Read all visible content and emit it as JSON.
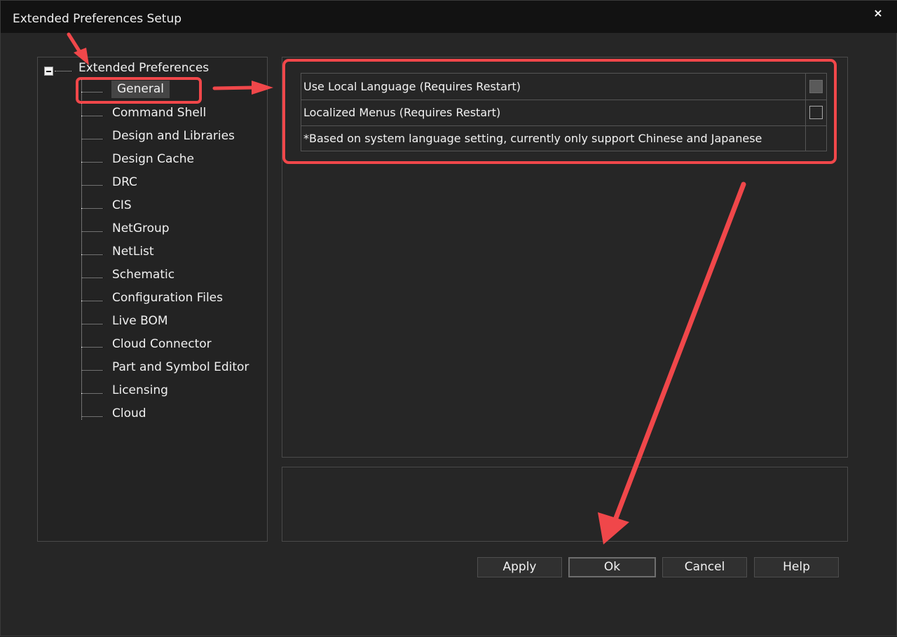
{
  "window": {
    "title": "Extended Preferences Setup",
    "close_glyph": "×"
  },
  "tree": {
    "root_label": "Extended Preferences",
    "items": [
      {
        "label": "General",
        "selected": true
      },
      {
        "label": "Command Shell"
      },
      {
        "label": "Design and Libraries"
      },
      {
        "label": "Design Cache"
      },
      {
        "label": "DRC"
      },
      {
        "label": "CIS"
      },
      {
        "label": "NetGroup"
      },
      {
        "label": "NetList"
      },
      {
        "label": "Schematic"
      },
      {
        "label": "Configuration Files"
      },
      {
        "label": "Live BOM"
      },
      {
        "label": "Cloud Connector"
      },
      {
        "label": "Part and Symbol Editor"
      },
      {
        "label": "Licensing"
      },
      {
        "label": "Cloud"
      }
    ]
  },
  "settings": {
    "rows": [
      {
        "label": "Use Local Language (Requires Restart)",
        "checkbox": "filled"
      },
      {
        "label": "Localized Menus (Requires Restart)",
        "checkbox": "unchecked"
      },
      {
        "label": "*Based on system language setting, currently only support Chinese and Japanese",
        "checkbox": "none"
      }
    ]
  },
  "buttons": {
    "apply": "Apply",
    "ok": "Ok",
    "cancel": "Cancel",
    "help": "Help"
  },
  "colors": {
    "annotation": "#f0474a",
    "background": "#262626",
    "titlebar": "#121212"
  }
}
